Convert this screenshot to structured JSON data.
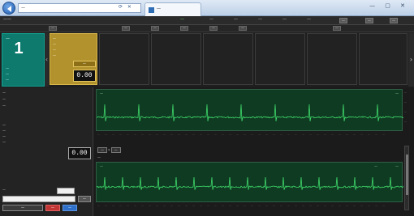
{
  "browser": {
    "address": "—",
    "tab_title": "—",
    "window_controls": "— ▢ ✕"
  },
  "header": {
    "app_title": "——",
    "status_text": "—",
    "items": [
      "—",
      "—",
      "—",
      "—",
      "—"
    ],
    "chips": [
      "—",
      "—",
      "—"
    ]
  },
  "subbar": {
    "chips": [
      "—",
      "—",
      "—",
      "—",
      "—",
      "—",
      "—"
    ]
  },
  "counter": {
    "label": "—",
    "value": "1",
    "lines": [
      "—",
      "—",
      "—"
    ]
  },
  "active_card": {
    "lines": [
      "—",
      "—",
      "—",
      "—"
    ],
    "badge": "—",
    "value": "0.00"
  },
  "left_panel": {
    "lines": [
      "—",
      "—",
      "—",
      "—",
      "—",
      "—",
      "—",
      "—"
    ],
    "value": "0.00",
    "buttons": [
      "—",
      "—",
      "—",
      "—"
    ]
  },
  "charts": {
    "top": {
      "title": "—",
      "tag": "—"
    },
    "bottom": {
      "title": "—",
      "tag": "—",
      "tag2": "—"
    },
    "toolbar": {
      "select1": "—",
      "select2": "—",
      "options": "—"
    },
    "y_ticks": [
      "—",
      "—",
      "—",
      "—"
    ],
    "x_tick": "—"
  },
  "colors": {
    "signal": "#3fd96a",
    "plot_bg": "#0f3b22",
    "accent_teal": "#0e7a6e",
    "accent_gold": "#b2922c"
  }
}
